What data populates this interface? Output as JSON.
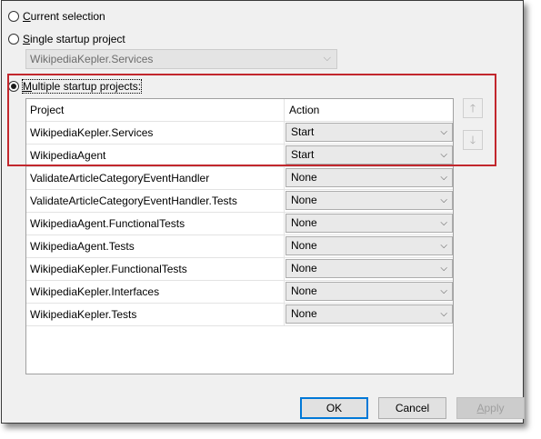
{
  "options": {
    "current_selection": {
      "accel": "C",
      "rest": "urrent selection"
    },
    "single_startup": {
      "accel": "S",
      "rest": "ingle startup project"
    },
    "single_startup_value": "WikipediaKepler.Services",
    "multiple_startup": {
      "accel": "M",
      "rest": "ultiple startup projects:"
    },
    "selected": "multiple"
  },
  "grid": {
    "headers": {
      "project": "Project",
      "action": "Action"
    },
    "rows": [
      {
        "project": "WikipediaKepler.Services",
        "action": "Start"
      },
      {
        "project": "WikipediaAgent",
        "action": "Start"
      },
      {
        "project": "ValidateArticleCategoryEventHandler",
        "action": "None"
      },
      {
        "project": "ValidateArticleCategoryEventHandler.Tests",
        "action": "None"
      },
      {
        "project": "WikipediaAgent.FunctionalTests",
        "action": "None"
      },
      {
        "project": "WikipediaAgent.Tests",
        "action": "None"
      },
      {
        "project": "WikipediaKepler.FunctionalTests",
        "action": "None"
      },
      {
        "project": "WikipediaKepler.Interfaces",
        "action": "None"
      },
      {
        "project": "WikipediaKepler.Tests",
        "action": "None"
      }
    ]
  },
  "side_buttons": {
    "move_up": "🡑",
    "move_down": "🡓"
  },
  "buttons": {
    "ok": "OK",
    "cancel": "Cancel",
    "apply": {
      "accel": "A",
      "rest": "pply"
    }
  },
  "colors": {
    "highlight": "#c2272d",
    "ok_border": "#0078d7"
  },
  "icons": {
    "dropdown": "chevron-down-icon",
    "up": "arrow-up-icon",
    "down": "arrow-down-icon"
  }
}
